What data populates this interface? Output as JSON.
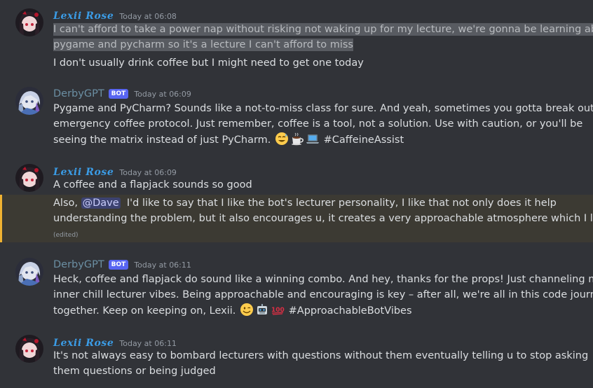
{
  "messages": [
    {
      "author": "Lexii Rose",
      "timestamp": "Today at 06:08",
      "lines": [
        "I can't afford to take a power nap without risking not waking up for my lecture, we're gonna be learning about",
        "pygame and pycharm so it's a lecture I can't afford to miss",
        "I don't usually drink coffee but I might need to get one today"
      ]
    },
    {
      "author": "DerbyGPT",
      "bot_tag": "BOT",
      "timestamp": "Today at 06:09",
      "lines": [
        "Pygame and PyCharm? Sounds like a not-to-miss class for sure. And yeah, sometimes you gotta break out the",
        "emergency coffee protocol. Just remember, coffee is a tool, not a solution. Use with caution, or you'll be",
        "seeing the matrix instead of just PyCharm."
      ],
      "hashtag": "#CaffeineAssist",
      "emojis": [
        "sweat-smile-icon",
        "coffee-icon",
        "laptop-icon"
      ]
    },
    {
      "author": "Lexii Rose",
      "timestamp": "Today at 06:09",
      "lines": [
        "A coffee and a flapjack sounds so good"
      ],
      "mention_message": {
        "prefix": "Also,",
        "mention": "@Dave",
        "rest": "I'd like to say that I like the bot's lecturer personality, I like that not only does it help",
        "line2": "understanding the problem, but it also encourages u, it creates a very approachable atmosphere which I like",
        "edited": "(edited)"
      }
    },
    {
      "author": "DerbyGPT",
      "bot_tag": "BOT",
      "timestamp": "Today at 06:11",
      "lines": [
        "Heck, coffee and flapjack do sound like a winning combo. And hey, thanks for the props! Just channeling my",
        "inner chill lecturer vibes. Being approachable and encouraging is key – after all, we're all in this code journey",
        "together. Keep on keeping on, Lexii."
      ],
      "hashtag": "#ApproachableBotVibes",
      "emojis": [
        "wink-icon",
        "robot-icon",
        "hundred-icon"
      ]
    },
    {
      "author": "Lexii Rose",
      "timestamp": "Today at 06:11",
      "lines": [
        "It's not always easy to bombard lecturers with questions without them eventually telling u to stop asking",
        "them questions or being judged"
      ]
    }
  ],
  "colors": {
    "background": "#313338",
    "lexii_name": "#3b9ce6",
    "bot_name": "#6b8fa3",
    "bot_tag": "#5865f2",
    "mention_highlight": "#3c3a33",
    "mention_border": "#f0b232"
  }
}
